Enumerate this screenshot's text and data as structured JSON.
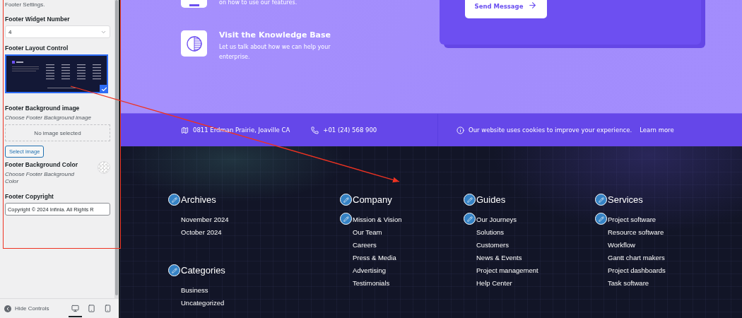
{
  "sidebar": {
    "intro": "Footer Settings.",
    "widget_number": {
      "label": "Footer Widget Number",
      "value": "4"
    },
    "layout_control": {
      "label": "Footer Layout Control",
      "options": [
        {
          "selected": true
        }
      ]
    },
    "background_image": {
      "label": "Footer Background image",
      "description": "Choose Footer Background image",
      "status": "No image selected",
      "button": "Select image"
    },
    "background_color": {
      "label": "Footer Background Color",
      "description": "Choose Footer Background Color"
    },
    "copyright": {
      "label": "Footer Copyright",
      "value": "Copyright © 2024 Infinia. All Rights R"
    },
    "bottom_bar": {
      "hide_controls": "Hide Controls",
      "devices": [
        {
          "kind": "desktop",
          "selected": true
        },
        {
          "kind": "tablet",
          "selected": false
        },
        {
          "kind": "mobile",
          "selected": false
        }
      ]
    }
  },
  "preview": {
    "support_items": [
      {
        "kind": "features",
        "text": "on how to use our features."
      },
      {
        "kind": "knowledge",
        "title": "Visit the Knowledge Base",
        "text": "Let us talk about how we can help your enterprise."
      }
    ],
    "send_button": "Send Message",
    "contact": {
      "address": "0811 Erdman Prairie, Joaville CA",
      "phone": "+01 (24) 568 900"
    },
    "cookie": {
      "text": "Our website uses cookies to improve your experience.",
      "link": "Learn more"
    },
    "footer_columns": [
      {
        "widgets": [
          {
            "title": "Archives",
            "items": [
              {
                "label": "November 2024",
                "edit_shortcut": false
              },
              {
                "label": "October 2024",
                "edit_shortcut": false
              }
            ]
          },
          {
            "title": "Categories",
            "items": [
              {
                "label": "Business",
                "edit_shortcut": false
              },
              {
                "label": "Uncategorized",
                "edit_shortcut": false
              }
            ]
          }
        ]
      },
      {
        "widgets": [
          {
            "title": "Company",
            "items": [
              {
                "label": "Mission & Vision",
                "edit_shortcut": true
              },
              {
                "label": "Our Team",
                "edit_shortcut": false
              },
              {
                "label": "Careers",
                "edit_shortcut": false
              },
              {
                "label": "Press & Media",
                "edit_shortcut": false
              },
              {
                "label": "Advertising",
                "edit_shortcut": false
              },
              {
                "label": "Testimonials",
                "edit_shortcut": false
              }
            ]
          }
        ]
      },
      {
        "widgets": [
          {
            "title": "Guides",
            "items": [
              {
                "label": "Our Journeys",
                "edit_shortcut": true
              },
              {
                "label": "Solutions",
                "edit_shortcut": false
              },
              {
                "label": "Customers",
                "edit_shortcut": false
              },
              {
                "label": "News & Events",
                "edit_shortcut": false
              },
              {
                "label": "Project management",
                "edit_shortcut": false
              },
              {
                "label": "Help Center",
                "edit_shortcut": false
              }
            ]
          }
        ]
      },
      {
        "widgets": [
          {
            "title": "Services",
            "items": [
              {
                "label": "Project software",
                "edit_shortcut": true
              },
              {
                "label": "Resource software",
                "edit_shortcut": false
              },
              {
                "label": "Workflow",
                "edit_shortcut": false
              },
              {
                "label": "Gantt chart makers",
                "edit_shortcut": false
              },
              {
                "label": "Project dashboards",
                "edit_shortcut": false
              },
              {
                "label": "Task software",
                "edit_shortcut": false
              }
            ]
          }
        ]
      }
    ]
  }
}
